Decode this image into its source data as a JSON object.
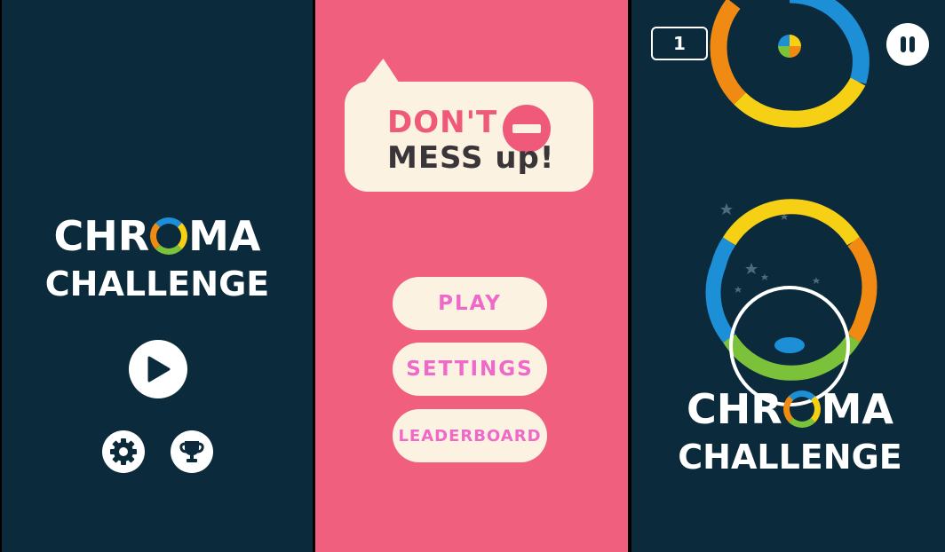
{
  "screen1": {
    "logo_line1_a": "CHR",
    "logo_line1_b": "MA",
    "logo_line2": "CHALLENGE",
    "play_icon": "play-icon",
    "settings_icon": "gear-icon",
    "leaderboard_icon": "trophy-icon"
  },
  "screen2": {
    "speech_line1": "DON'T",
    "speech_line2": "MESS up!",
    "no_entry_icon": "no-entry-icon",
    "buttons": {
      "play": "PLAY",
      "settings": "SETTINGS",
      "leaderboard": "LEADERBOARD"
    }
  },
  "screen3": {
    "score": "1",
    "pause_icon": "pause-icon",
    "logo_line1_a": "CHR",
    "logo_line1_b": "MA",
    "logo_line2": "CHALLENGE"
  },
  "colors": {
    "navy": "#0b2a3b",
    "pink": "#f0607e",
    "cream": "#fcf2e1",
    "blue": "#1d8fd6",
    "orange": "#f08a12",
    "yellow": "#f5d015",
    "green": "#7cc13a",
    "magenta": "#ef69c9"
  }
}
